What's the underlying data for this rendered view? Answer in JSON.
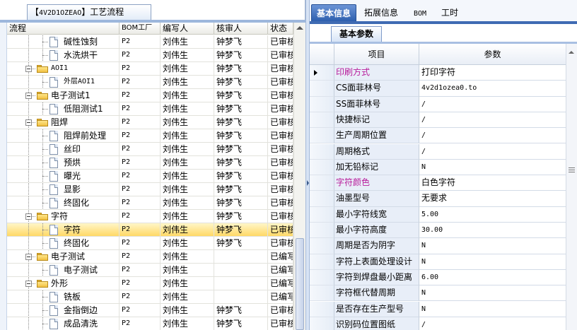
{
  "process_panel": {
    "tab_code": "4V2D1OZEAO",
    "tab_title": "工艺流程",
    "columns": [
      "流程",
      "BOM工厂",
      "编写人",
      "核审人",
      "状态"
    ],
    "rows": [
      {
        "label": "碱性蚀刻",
        "bom": "P2",
        "writer": "刘伟生",
        "reviewer": "钟梦飞",
        "status": "已审核"
      },
      {
        "label": "水洗烘干",
        "bom": "P2",
        "writer": "刘伟生",
        "reviewer": "钟梦飞",
        "status": "已审核"
      },
      {
        "label": "AOI1",
        "bom": "P2",
        "writer": "刘伟生",
        "reviewer": "钟梦飞",
        "status": "已审核"
      },
      {
        "label": "外层AOI1",
        "bom": "P2",
        "writer": "刘伟生",
        "reviewer": "钟梦飞",
        "status": "已审核"
      },
      {
        "label": "电子测试1",
        "bom": "P2",
        "writer": "刘伟生",
        "reviewer": "钟梦飞",
        "status": "已审核"
      },
      {
        "label": "低阻测试1",
        "bom": "P2",
        "writer": "刘伟生",
        "reviewer": "钟梦飞",
        "status": "已审核"
      },
      {
        "label": "阻焊",
        "bom": "P2",
        "writer": "刘伟生",
        "reviewer": "钟梦飞",
        "status": "已审核"
      },
      {
        "label": "阻焊前处理",
        "bom": "P2",
        "writer": "刘伟生",
        "reviewer": "钟梦飞",
        "status": "已审核"
      },
      {
        "label": "丝印",
        "bom": "P2",
        "writer": "刘伟生",
        "reviewer": "钟梦飞",
        "status": "已审核"
      },
      {
        "label": "预烘",
        "bom": "P2",
        "writer": "刘伟生",
        "reviewer": "钟梦飞",
        "status": "已审核"
      },
      {
        "label": "曝光",
        "bom": "P2",
        "writer": "刘伟生",
        "reviewer": "钟梦飞",
        "status": "已审核"
      },
      {
        "label": "显影",
        "bom": "P2",
        "writer": "刘伟生",
        "reviewer": "钟梦飞",
        "status": "已审核"
      },
      {
        "label": "终固化",
        "bom": "P2",
        "writer": "刘伟生",
        "reviewer": "钟梦飞",
        "status": "已审核"
      },
      {
        "label": "字符",
        "bom": "P2",
        "writer": "刘伟生",
        "reviewer": "钟梦飞",
        "status": "已审核"
      },
      {
        "label": "字符",
        "bom": "P2",
        "writer": "刘伟生",
        "reviewer": "钟梦飞",
        "status": "已审核"
      },
      {
        "label": "终固化",
        "bom": "P2",
        "writer": "刘伟生",
        "reviewer": "钟梦飞",
        "status": "已审核"
      },
      {
        "label": "电子测试",
        "bom": "P2",
        "writer": "刘伟生",
        "reviewer": "",
        "status": "已编写"
      },
      {
        "label": "电子测试",
        "bom": "P2",
        "writer": "刘伟生",
        "reviewer": "",
        "status": "已编写"
      },
      {
        "label": "外形",
        "bom": "P2",
        "writer": "刘伟生",
        "reviewer": "",
        "status": "已编写"
      },
      {
        "label": "铣板",
        "bom": "P2",
        "writer": "刘伟生",
        "reviewer": "",
        "status": "已编写"
      },
      {
        "label": "金指倒边",
        "bom": "P2",
        "writer": "刘伟生",
        "reviewer": "钟梦飞",
        "status": "已审核"
      },
      {
        "label": "成品清洗",
        "bom": "P2",
        "writer": "刘伟生",
        "reviewer": "钟梦飞",
        "status": "已审核"
      }
    ]
  },
  "detail_panel": {
    "tabs": [
      "基本信息",
      "拓展信息",
      "BOM",
      "工时"
    ],
    "active_tab": "基本信息",
    "subtab": "基本参数",
    "columns": {
      "item": "项目",
      "param": "参数"
    },
    "rows": [
      {
        "name": "印刷方式",
        "value": "打印字符"
      },
      {
        "name": "CS面菲林号",
        "value": "4v2d1ozea0.to"
      },
      {
        "name": "SS面菲林号",
        "value": "/"
      },
      {
        "name": "快捷标记",
        "value": "/"
      },
      {
        "name": "生产周期位置",
        "value": "/"
      },
      {
        "name": "周期格式",
        "value": "/"
      },
      {
        "name": "加无铅标记",
        "value": "N"
      },
      {
        "name": "字符颜色",
        "value": "白色字符"
      },
      {
        "name": "油墨型号",
        "value": "无要求"
      },
      {
        "name": "最小字符线宽",
        "value": "5.00"
      },
      {
        "name": "最小字符高度",
        "value": "30.00"
      },
      {
        "name": "周期是否为阴字",
        "value": "N"
      },
      {
        "name": "字符上表面处理设计",
        "value": "N"
      },
      {
        "name": "字符到焊盘最小距离",
        "value": "6.00"
      },
      {
        "name": "字符框代替周期",
        "value": "N"
      },
      {
        "name": "是否存在生产型号",
        "value": "N"
      },
      {
        "name": "识别码位置图纸",
        "value": "/"
      }
    ]
  }
}
